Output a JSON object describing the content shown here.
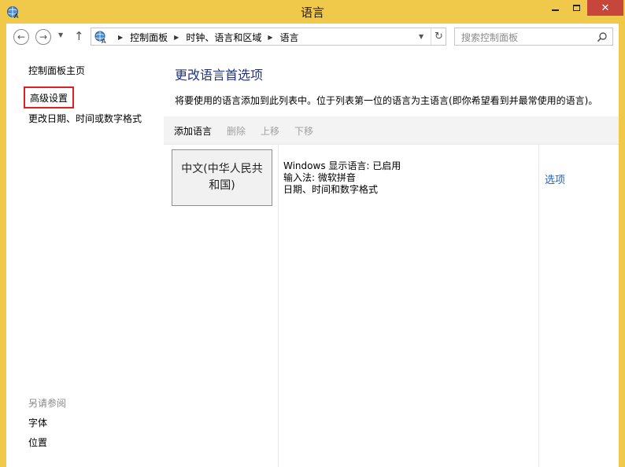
{
  "window": {
    "title": "语言",
    "controls": {
      "minimize": "minimize-icon",
      "maximize": "maximize-icon",
      "close": "✕"
    }
  },
  "address_bar": {
    "breadcrumbs": [
      "控制面板",
      "时钟、语言和区域",
      "语言"
    ],
    "search_placeholder": "搜索控制面板"
  },
  "sidebar": {
    "home": "控制面板主页",
    "advanced": "高级设置",
    "date_time": "更改日期、时间或数字格式",
    "see_also_title": "另请参阅",
    "see_also": [
      "字体",
      "位置"
    ]
  },
  "main": {
    "title": "更改语言首选项",
    "description": "将要使用的语言添加到此列表中。位于列表第一位的语言为主语言(即你希望看到并最常使用的语言)。",
    "toolbar": {
      "add": "添加语言",
      "remove": "删除",
      "up": "上移",
      "down": "下移"
    },
    "languages": [
      {
        "name": "中文(中华人民共和国)",
        "details": [
          "Windows 显示语言: 已启用",
          "输入法: 微软拼音",
          "日期、时间和数字格式"
        ],
        "options_label": "选项"
      }
    ]
  },
  "colors": {
    "titlebar": "#f0c84a",
    "link_heading": "#1e3287",
    "link": "#1c62c0",
    "highlight_box": "#e02020",
    "close_button": "#c7463c"
  }
}
